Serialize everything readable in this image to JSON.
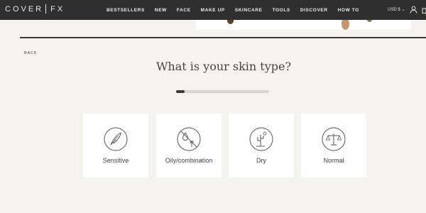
{
  "header": {
    "logo_left": "COVER",
    "logo_right": "FX",
    "nav": [
      "BESTSELLERS",
      "NEW",
      "FACE",
      "MAKE UP",
      "SKINCARE",
      "TOOLS",
      "DISCOVER",
      "HOW TO"
    ],
    "currency": "USD $ ⌄"
  },
  "quiz": {
    "back": "BACK",
    "question": "What is your skin type?",
    "progress": 0.09,
    "options": [
      {
        "label": "Sensitive",
        "icon": "feather-icon"
      },
      {
        "label": "Oily/combination",
        "icon": "droplet-cactus-icon"
      },
      {
        "label": "Dry",
        "icon": "cactus-sun-icon"
      },
      {
        "label": "Normal",
        "icon": "balance-scale-icon"
      }
    ]
  },
  "colors": {
    "nav_bg": "#2f2f2f",
    "page_bg": "#f4f3ef",
    "accent": "#3a3a3a"
  }
}
